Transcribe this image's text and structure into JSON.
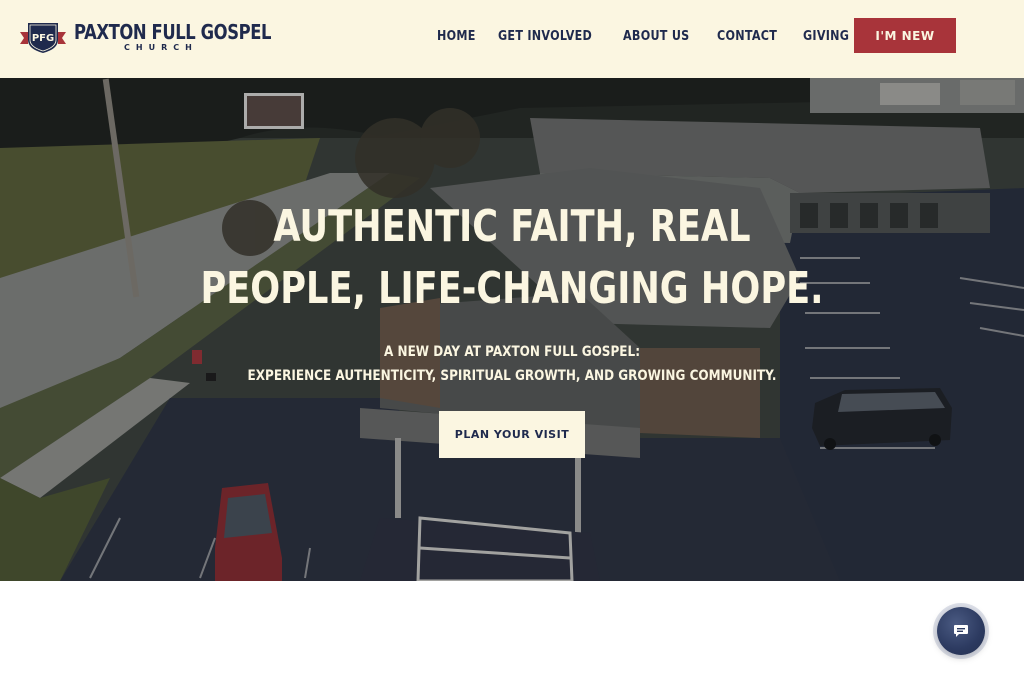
{
  "header": {
    "logo": {
      "badge_text": "PFG",
      "name": "PAXTON FULL GOSPEL",
      "subtitle": "CHURCH"
    },
    "nav": [
      {
        "label": "HOME"
      },
      {
        "label": "GET INVOLVED"
      },
      {
        "label": "ABOUT US"
      },
      {
        "label": "CONTACT"
      },
      {
        "label": "GIVING"
      }
    ],
    "cta_label": "I'M NEW"
  },
  "hero": {
    "title_line1": "AUTHENTIC FAITH, REAL",
    "title_line2": "PEOPLE, LIFE-CHANGING HOPE.",
    "subtitle_line1": "A NEW DAY AT PAXTON FULL GOSPEL:",
    "subtitle_line2": "EXPERIENCE AUTHENTICITY, SPIRITUAL GROWTH, AND GROWING COMMUNITY.",
    "cta_label": "PLAN YOUR VISIT",
    "background_icon": "aerial-church-photo"
  },
  "chat": {
    "icon": "chat-bubble-icon"
  },
  "colors": {
    "header_bg": "#fbf6e1",
    "navy": "#1f2a4d",
    "accent_red": "#a8343a",
    "cream": "#fbf6e1"
  }
}
